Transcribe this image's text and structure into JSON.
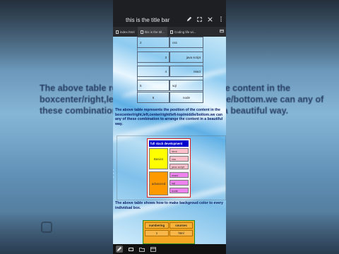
{
  "window": {
    "title": "this is the title bar",
    "icons": [
      "pen-icon",
      "fullscreen-icon",
      "close-icon",
      "more-vert-icon"
    ]
  },
  "tabs": [
    {
      "label": "index.html"
    },
    {
      "label": "this is the titl..."
    },
    {
      "label": "Coding life wi..."
    }
  ],
  "table1": {
    "rows": [
      {
        "col1": "2",
        "col2": "css"
      },
      {
        "col1": "3",
        "col2": "java script"
      },
      {
        "col1": "4",
        "col2": "react"
      },
      {
        "col1": "5",
        "col2": "sql"
      },
      {
        "col1": "6",
        "col2": "node"
      }
    ]
  },
  "paragraph1": "The above table represents the position of the content in the boxcenter/right,left,center/right/left-top/middle/bottom.we can any of these combination to arrange the content in a beautiful way.",
  "table2": {
    "header": "full stack development",
    "groups": [
      {
        "label": "Basics",
        "items": [
          "html",
          "css",
          "java script"
        ]
      },
      {
        "label": "advanced",
        "items": [
          "react",
          "sql",
          "node"
        ]
      }
    ]
  },
  "paragraph2": "The above table shows how to make backgroud color to every individual box.",
  "table3": {
    "headers": [
      "numbering",
      "courses"
    ],
    "row": [
      "1",
      "html"
    ]
  },
  "background_text": "The above table represents the position of the content in the boxcenter/right,left,center/right/left-top/middle/bottom.we can any of these combination to arrange the content in a beautiful way.",
  "colors": {
    "title_bar": "#1e1f22",
    "paragraph_text": "#0b1d66",
    "table2_header": "#0000cc",
    "basics_fill": "#ffff00",
    "advanced_fill": "#ff9900",
    "pink_fill": "#ffc0cb",
    "violet_fill": "#ee82ee",
    "table2_border": "#d92020",
    "table3_border": "#228b22",
    "table3_fill": "#f5a623"
  }
}
